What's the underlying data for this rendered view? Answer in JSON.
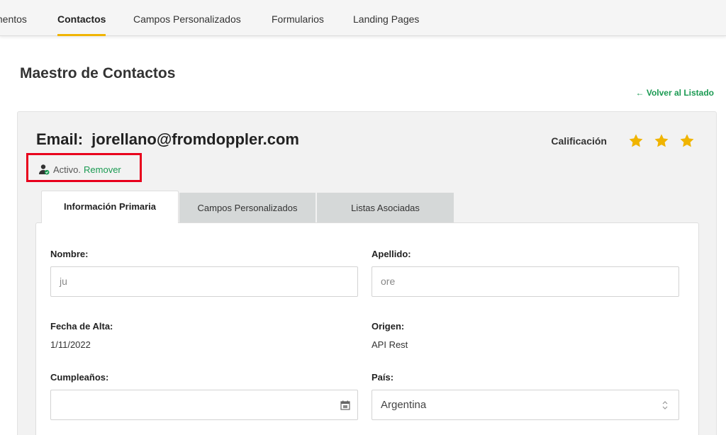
{
  "nav": {
    "items": [
      {
        "label": "mentos",
        "active": false
      },
      {
        "label": "Contactos",
        "active": true
      },
      {
        "label": "Campos Personalizados",
        "active": false
      },
      {
        "label": "Formularios",
        "active": false
      },
      {
        "label": "Landing Pages",
        "active": false
      }
    ],
    "accent_color": "#f0b400"
  },
  "page": {
    "title": "Maestro de Contactos",
    "back_link": "← Volver al Listado"
  },
  "contact": {
    "email_label": "Email:",
    "email": "jorellano@fromdoppler.com",
    "status_text": "Activo.",
    "status_action": "Remover",
    "rating_label": "Calificación",
    "rating_stars": 3,
    "rating_max": 3
  },
  "tabs": [
    {
      "label": "Información Primaria",
      "active": true
    },
    {
      "label": "Campos Personalizados",
      "active": false
    },
    {
      "label": "Listas Asociadas",
      "active": false
    }
  ],
  "fields": {
    "nombre": {
      "label": "Nombre:",
      "value": "ju"
    },
    "apellido": {
      "label": "Apellido:",
      "value": "ore"
    },
    "fecha_alta": {
      "label": "Fecha de Alta:",
      "value": "1/11/2022"
    },
    "origen": {
      "label": "Origen:",
      "value": "API Rest"
    },
    "cumpleanos": {
      "label": "Cumpleaños:",
      "value": ""
    },
    "pais": {
      "label": "País:",
      "value": "Argentina"
    }
  },
  "colors": {
    "link_green": "#1a9a52",
    "star_color": "#f0b400",
    "highlight_red": "#e8001c"
  },
  "icons": [
    "user-check-icon",
    "star-icon",
    "calendar-icon",
    "select-arrows-icon"
  ]
}
